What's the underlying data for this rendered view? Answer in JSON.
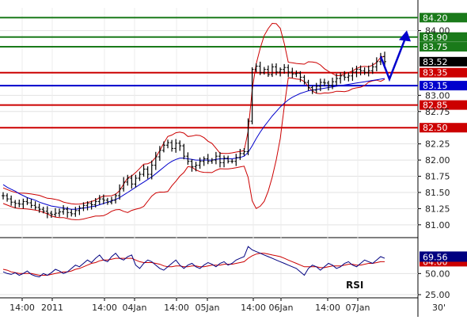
{
  "chart_data": [
    {
      "type": "candlestick",
      "panel": "price",
      "ylim": [
        80.9,
        84.35
      ],
      "y_ticks": [
        "81.00",
        "81.25",
        "81.50",
        "81.75",
        "82.00",
        "82.25",
        "82.75",
        "83.00",
        "84.00"
      ],
      "x_ticks": [
        "14:00",
        "2011",
        "14:00",
        "04Jan",
        "14:00",
        "05Jan",
        "14:00",
        "06Jan",
        "14:00",
        "07Jan"
      ],
      "timeframe": "30'",
      "series": {
        "close": [
          81.45,
          81.4,
          81.35,
          81.33,
          81.32,
          81.36,
          81.34,
          81.3,
          81.27,
          81.24,
          81.21,
          81.18,
          81.16,
          81.18,
          81.2,
          81.24,
          81.19,
          81.17,
          81.22,
          81.26,
          81.3,
          81.33,
          81.31,
          81.36,
          81.4,
          81.38,
          81.35,
          81.38,
          81.45,
          81.56,
          81.66,
          81.72,
          81.63,
          81.72,
          81.78,
          81.86,
          81.78,
          81.92,
          82.05,
          82.15,
          82.23,
          82.27,
          82.18,
          82.26,
          82.22,
          82.06,
          81.98,
          81.9,
          81.92,
          81.98,
          82.02,
          81.98,
          82.0,
          82.06,
          81.96,
          82.03,
          81.98,
          81.98,
          82.04,
          82.1,
          82.13,
          82.6,
          83.4,
          83.45,
          83.35,
          83.4,
          83.32,
          83.44,
          83.36,
          83.4,
          83.43,
          83.36,
          83.33,
          83.34,
          83.28,
          83.2,
          83.12,
          83.08,
          83.14,
          83.2,
          83.19,
          83.15,
          83.21,
          83.26,
          83.3,
          83.28,
          83.3,
          83.36,
          83.4,
          83.38,
          83.35,
          83.38,
          83.44,
          83.52,
          83.6,
          83.52
        ],
        "ma": [
          81.62,
          81.58,
          81.55,
          81.52,
          81.48,
          81.45,
          81.42,
          81.4,
          81.38,
          81.35,
          81.33,
          81.31,
          81.29,
          81.28,
          81.27,
          81.26,
          81.25,
          81.24,
          81.24,
          81.25,
          81.26,
          81.27,
          81.28,
          81.29,
          81.31,
          81.33,
          81.35,
          81.37,
          81.39,
          81.42,
          81.46,
          81.5,
          81.54,
          81.58,
          81.62,
          81.66,
          81.7,
          81.74,
          81.79,
          81.84,
          81.89,
          81.94,
          81.98,
          82.01,
          82.03,
          82.03,
          82.02,
          82.01,
          82.0,
          82.0,
          82.0,
          82.0,
          82.0,
          82.01,
          82.02,
          82.02,
          82.02,
          82.02,
          82.03,
          82.04,
          82.06,
          82.12,
          82.22,
          82.33,
          82.43,
          82.52,
          82.6,
          82.68,
          82.75,
          82.82,
          82.88,
          82.93,
          82.97,
          83.0,
          83.03,
          83.05,
          83.07,
          83.08,
          83.09,
          83.1,
          83.11,
          83.12,
          83.13,
          83.14,
          83.15,
          83.16,
          83.17,
          83.18,
          83.19,
          83.2,
          83.21,
          83.22,
          83.23,
          83.24,
          83.25,
          83.26
        ]
      },
      "levels": [
        {
          "value": 84.2,
          "label": "84.20",
          "color": "#1a7a1a"
        },
        {
          "value": 83.9,
          "label": "83.90",
          "color": "#1a7a1a"
        },
        {
          "value": 83.75,
          "label": "83.75",
          "color": "#1a7a1a"
        },
        {
          "value": 83.35,
          "label": "83.35",
          "color": "#cc0000"
        },
        {
          "value": 83.15,
          "label": "83.15",
          "color": "#0000cc"
        },
        {
          "value": 82.85,
          "label": "82.85",
          "color": "#cc0000"
        },
        {
          "value": 82.5,
          "label": "82.50",
          "color": "#cc0000"
        }
      ],
      "last_price": {
        "value": 83.52,
        "label": "83.52"
      },
      "bollinger_color": "#cc0000",
      "ma_color": "#0000cc",
      "forecast_arrow": {
        "from": 83.3,
        "to": 83.88,
        "color": "#0000cc"
      }
    },
    {
      "type": "line",
      "panel": "indicator",
      "title": "RSI",
      "ylim": [
        25,
        85
      ],
      "y_ticks": [
        "25.00",
        "50.00"
      ],
      "current": {
        "value": 69.56,
        "label": "69.56"
      },
      "signal_tag": "64.00",
      "rsi_color": "#000080",
      "signal_color": "#cc0000",
      "values": [
        52,
        50,
        49,
        51,
        48,
        50,
        53,
        49,
        47,
        46,
        50,
        48,
        51,
        55,
        53,
        50,
        52,
        56,
        60,
        58,
        62,
        66,
        63,
        68,
        72,
        66,
        64,
        70,
        74,
        68,
        66,
        70,
        72,
        60,
        56,
        62,
        66,
        64,
        60,
        56,
        54,
        58,
        62,
        66,
        60,
        56,
        60,
        62,
        58,
        56,
        60,
        63,
        61,
        58,
        62,
        64,
        60,
        62,
        66,
        68,
        70,
        82,
        78,
        76,
        74,
        72,
        70,
        68,
        66,
        64,
        62,
        60,
        58,
        56,
        52,
        48,
        56,
        60,
        58,
        54,
        58,
        62,
        60,
        56,
        58,
        62,
        64,
        60,
        58,
        62,
        66,
        64,
        62,
        66,
        70,
        68
      ],
      "signal": [
        55,
        54,
        52,
        51,
        50,
        50,
        50,
        50,
        49,
        48,
        48,
        48,
        49,
        50,
        51,
        52,
        52,
        53,
        55,
        56,
        58,
        60,
        62,
        63,
        65,
        66,
        66,
        67,
        68,
        68,
        68,
        68,
        68,
        66,
        64,
        63,
        63,
        63,
        62,
        61,
        59,
        58,
        58,
        59,
        59,
        58,
        58,
        59,
        59,
        58,
        58,
        59,
        60,
        60,
        60,
        61,
        61,
        61,
        62,
        63,
        64,
        68,
        71,
        73,
        74,
        74,
        73,
        72,
        71,
        70,
        68,
        66,
        64,
        62,
        60,
        58,
        58,
        58,
        58,
        57,
        57,
        58,
        59,
        59,
        59,
        60,
        61,
        61,
        60,
        60,
        61,
        62,
        62,
        63,
        64,
        64
      ]
    }
  ]
}
